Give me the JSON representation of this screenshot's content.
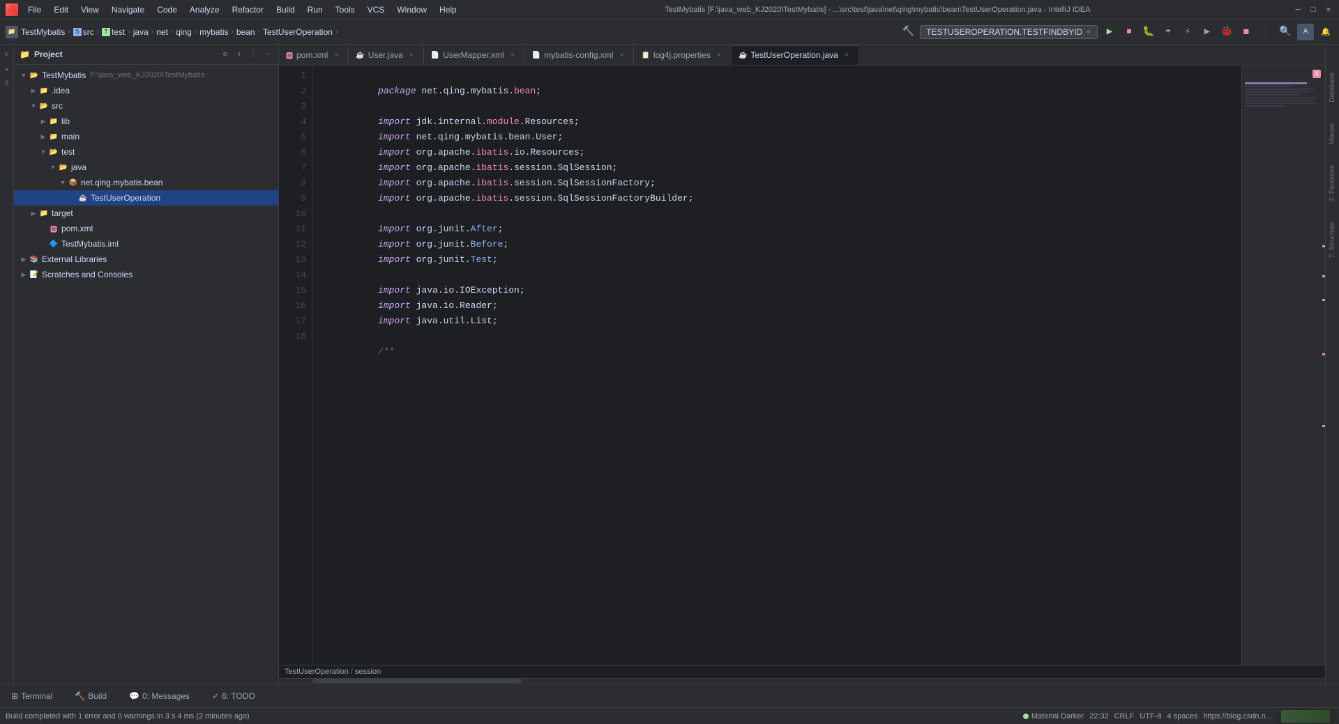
{
  "window": {
    "title": "TestMybatis [F:\\java_web_KJ2020\\TestMybatis] - ...\\src\\test\\java\\net\\qing\\mybatis\\bean\\TestUserOperation.java - IntelliJ IDEA",
    "logo": "🔴"
  },
  "menu": {
    "items": [
      "File",
      "Edit",
      "View",
      "Navigate",
      "Code",
      "Analyze",
      "Refactor",
      "Build",
      "Run",
      "Tools",
      "VCS",
      "Window",
      "Help"
    ]
  },
  "toolbar": {
    "breadcrumb": [
      "TestMybatis",
      "src",
      "test",
      "java",
      "net",
      "qing",
      "mybatis",
      "bean",
      "TestUserOperation"
    ],
    "run_config": "TESTUSEROPERATION.TESTFINDBYID",
    "chevron": "▼"
  },
  "sidebar": {
    "title": "Project",
    "tree": [
      {
        "label": "TestMybatis",
        "indent": 0,
        "type": "project",
        "expanded": true
      },
      {
        "label": ".idea",
        "indent": 1,
        "type": "folder",
        "expanded": false
      },
      {
        "label": "src",
        "indent": 1,
        "type": "src",
        "expanded": true
      },
      {
        "label": "lib",
        "indent": 2,
        "type": "folder",
        "expanded": false
      },
      {
        "label": "main",
        "indent": 2,
        "type": "folder",
        "expanded": false
      },
      {
        "label": "test",
        "indent": 2,
        "type": "folder",
        "expanded": true
      },
      {
        "label": "java",
        "indent": 3,
        "type": "java",
        "expanded": true
      },
      {
        "label": "net.qing.mybatis.bean",
        "indent": 4,
        "type": "package",
        "expanded": true
      },
      {
        "label": "TestUserOperation",
        "indent": 5,
        "type": "java",
        "selected": true
      },
      {
        "label": "target",
        "indent": 1,
        "type": "folder",
        "expanded": false
      },
      {
        "label": "pom.xml",
        "indent": 1,
        "type": "xml"
      },
      {
        "label": "TestMybatis.iml",
        "indent": 1,
        "type": "iml"
      },
      {
        "label": "External Libraries",
        "indent": 0,
        "type": "library",
        "expanded": false
      },
      {
        "label": "Scratches and Consoles",
        "indent": 0,
        "type": "scratches",
        "expanded": false
      }
    ]
  },
  "tabs": [
    {
      "label": "pom.xml",
      "type": "xml",
      "active": false
    },
    {
      "label": "User.java",
      "type": "java",
      "active": false
    },
    {
      "label": "UserMapper.xml",
      "type": "xml",
      "active": false
    },
    {
      "label": "mybatis-config.xml",
      "type": "xml",
      "active": false
    },
    {
      "label": "log4j.properties",
      "type": "properties",
      "active": false
    },
    {
      "label": "TestUserOperation.java",
      "type": "java",
      "active": true
    }
  ],
  "code": {
    "lines": [
      {
        "num": 1,
        "content": "package net.qing.mybatis.bean;"
      },
      {
        "num": 2,
        "content": ""
      },
      {
        "num": 3,
        "content": "import jdk.internal.module.Resources;"
      },
      {
        "num": 4,
        "content": "import net.qing.mybatis.bean.User;"
      },
      {
        "num": 5,
        "content": "import org.apache.ibatis.io.Resources;"
      },
      {
        "num": 6,
        "content": "import org.apache.ibatis.session.SqlSession;"
      },
      {
        "num": 7,
        "content": "import org.apache.ibatis.session.SqlSessionFactory;"
      },
      {
        "num": 8,
        "content": "import org.apache.ibatis.session.SqlSessionFactoryBuilder;"
      },
      {
        "num": 9,
        "content": ""
      },
      {
        "num": 10,
        "content": "import org.junit.After;"
      },
      {
        "num": 11,
        "content": "import org.junit.Before;"
      },
      {
        "num": 12,
        "content": "import org.junit.Test;"
      },
      {
        "num": 13,
        "content": ""
      },
      {
        "num": 14,
        "content": "import java.io.IOException;"
      },
      {
        "num": 15,
        "content": "import java.io.Reader;"
      },
      {
        "num": 16,
        "content": "import java.util.List;"
      },
      {
        "num": 17,
        "content": ""
      },
      {
        "num": 18,
        "content": "/**"
      }
    ]
  },
  "breadcrumb_path": {
    "file": "TestUserOperation",
    "sep": "/",
    "section": "session"
  },
  "bottom_tabs": [
    {
      "label": "Terminal",
      "icon": ">_"
    },
    {
      "label": "Build",
      "icon": "🔨"
    },
    {
      "label": "0: Messages",
      "icon": "💬"
    },
    {
      "label": "6: TODO",
      "icon": "✓"
    }
  ],
  "status_bar": {
    "build_status": "Build completed with 1 error and 0 warnings in 3 s 4 ms (2 minutes ago)",
    "theme": "Material Darker",
    "time": "22:32",
    "line_ending": "CRLF",
    "encoding": "UTF-8",
    "indent": "4 spaces",
    "url": "https://blog.csdn.n..."
  },
  "right_strip": {
    "labels": [
      "Database",
      "Maven",
      "2: Favorites",
      "7: Structure"
    ]
  },
  "error_count": "1"
}
